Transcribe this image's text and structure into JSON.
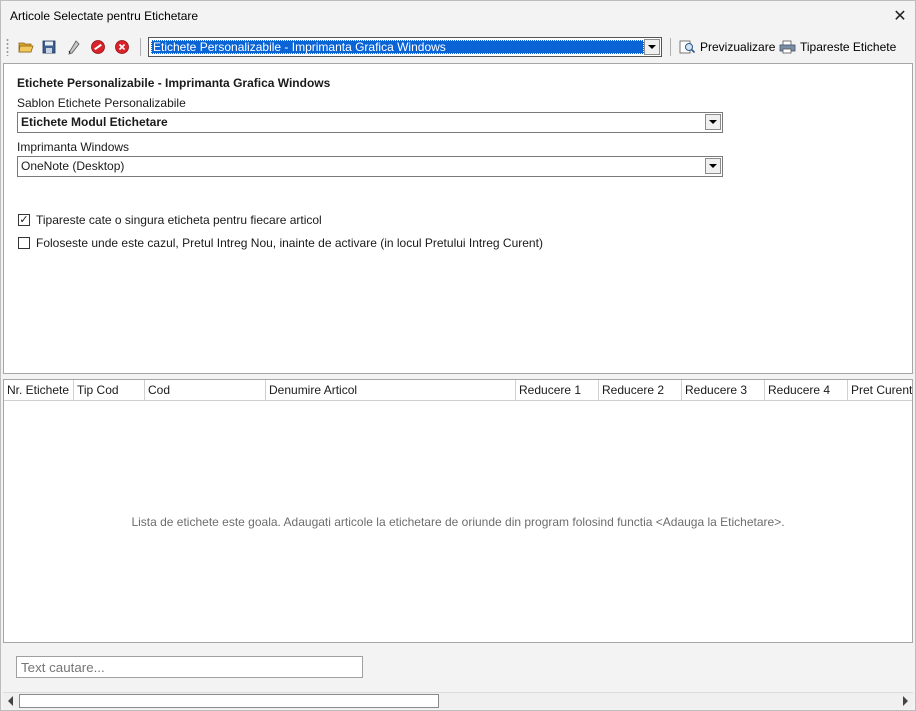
{
  "window": {
    "title": "Articole Selectate pentru Etichetare"
  },
  "toolbar": {
    "printer_mode": "Etichete Personalizabile - Imprimanta Grafica Windows",
    "preview_label": "Previzualizare",
    "print_label": "Tipareste Etichete"
  },
  "settings": {
    "heading": "Etichete Personalizabile - Imprimanta Grafica Windows",
    "template_label": "Sablon Etichete Personalizabile",
    "template_value": "Etichete Modul Etichetare",
    "printer_label": "Imprimanta Windows",
    "printer_value": "OneNote (Desktop)",
    "option1_label": "Tipareste cate o singura eticheta pentru fiecare articol",
    "option1_checked": true,
    "option2_label": "Foloseste unde este cazul, Pretul Intreg Nou, inainte de activare (in locul Pretului Intreg Curent)",
    "option2_checked": false
  },
  "grid": {
    "columns": [
      "Nr. Etichete",
      "Tip Cod",
      "Cod",
      "Denumire Articol",
      "Reducere 1",
      "Reducere 2",
      "Reducere 3",
      "Reducere 4",
      "Pret Curent"
    ],
    "empty_message": "Lista de etichete este goala. Adaugati articole la etichetare de oriunde din program folosind functia <Adauga la Etichetare>."
  },
  "search": {
    "placeholder": "Text cautare..."
  }
}
